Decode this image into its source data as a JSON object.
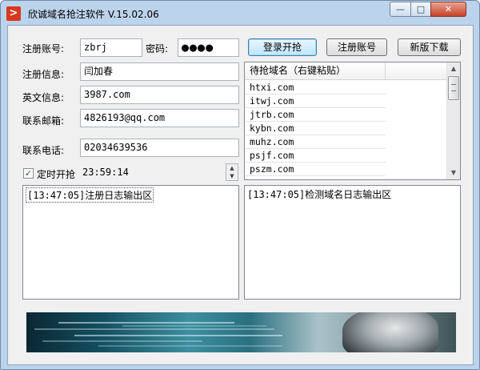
{
  "window": {
    "title": "欣诚域名抢注软件 V.15.02.06"
  },
  "controls": {
    "minimize": "—",
    "maximize": "□",
    "close": "✕"
  },
  "form": {
    "account_label": "注册账号:",
    "account_value": "zbrj",
    "password_label": "密码:",
    "password_value": "●●●●",
    "reg_info_label": "注册信息:",
    "reg_info_value": "闫加春",
    "en_info_label": "英文信息:",
    "en_info_value": "3987.com",
    "email_label": "联系邮箱:",
    "email_value": "4826193@qq.com",
    "phone_label": "联系电话:",
    "phone_value": "02034639536",
    "timer_label": "定时开抢",
    "timer_checked": true,
    "timer_value": "23:59:14"
  },
  "buttons": {
    "login_start": "登录开抢",
    "register": "注册账号",
    "download": "新版下载"
  },
  "domain_list": {
    "header": "待抢域名（右键粘贴）",
    "items": [
      "htxi.com",
      "itwj.com",
      "jtrb.com",
      "kybn.com",
      "muhz.com",
      "psjf.com",
      "pszm.com"
    ]
  },
  "logs": {
    "register_log": "[13:47:05]注册日志输出区",
    "check_log": "[13:47:05]检测域名日志输出区"
  }
}
